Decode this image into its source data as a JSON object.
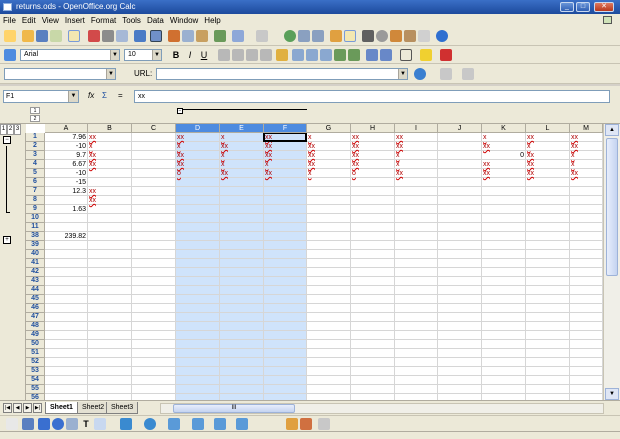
{
  "window": {
    "title": "returns.ods - OpenOffice.org Calc"
  },
  "menu": [
    "File",
    "Edit",
    "View",
    "Insert",
    "Format",
    "Tools",
    "Data",
    "Window",
    "Help"
  ],
  "format_toolbar": {
    "font_name": "Arial",
    "font_size": "10"
  },
  "url_toolbar": {
    "url_label": "URL:",
    "url_value": ""
  },
  "formula_bar": {
    "cell_ref": "F1",
    "content": "xx"
  },
  "outline_levels": [
    "1",
    "2",
    "3"
  ],
  "outline_col_levels": [
    "1",
    "2"
  ],
  "columns": [
    "A",
    "B",
    "C",
    "D",
    "E",
    "F",
    "G",
    "H",
    "I",
    "J",
    "K",
    "L",
    "M"
  ],
  "selected_columns": [
    "D",
    "E",
    "F"
  ],
  "rows": [
    "1",
    "2",
    "3",
    "4",
    "5",
    "6",
    "7",
    "8",
    "9",
    "10",
    "11",
    "38",
    "39",
    "40",
    "41",
    "42",
    "43",
    "44",
    "45",
    "46",
    "47",
    "48",
    "49",
    "50",
    "51",
    "52",
    "53",
    "54",
    "55",
    "56"
  ],
  "cells": {
    "A": {
      "1": "7.96",
      "2": "-10",
      "3": "9.7",
      "4": "6.67",
      "5": "-10",
      "6": "-15",
      "7": "12.3",
      "9": "1.63",
      "38": "239.82"
    },
    "B": {
      "1": "xx",
      "2": "x",
      "3": "xx",
      "4": "xx",
      "7": "xx",
      "8": "xx"
    },
    "D": {
      "1": "xx",
      "2": "x",
      "3": "xx",
      "4": "xx",
      "5": "o"
    },
    "E": {
      "1": "x",
      "2": "xx",
      "3": "x",
      "4": "x",
      "5": "xx"
    },
    "F": {
      "1": "xx",
      "2": "xx",
      "3": "xx",
      "4": "x",
      "5": "xx"
    },
    "G": {
      "1": "x",
      "2": "xx",
      "3": "xx",
      "4": "xx",
      "5": "x"
    },
    "H": {
      "1": "xx",
      "2": "xx",
      "3": "xx",
      "4": "xx",
      "5": "o"
    },
    "I": {
      "1": "xx",
      "2": "xx",
      "3": "x",
      "4": "x",
      "5": "xx"
    },
    "K": {
      "1": "x",
      "2": "xx",
      "3": "0",
      "4": "xx",
      "5": "xx"
    },
    "L": {
      "1": "xx",
      "2": "x",
      "3": "xx",
      "4": "xx",
      "5": "xx"
    },
    "M": {
      "1": "xx",
      "2": "xx",
      "3": "x",
      "4": "x",
      "5": "xx"
    }
  },
  "sheets": [
    "Sheet1",
    "Sheet2",
    "Sheet3"
  ],
  "active_sheet": "Sheet1",
  "scroll_thumb_label": "III",
  "colors": {
    "selection": "#cfe3fb",
    "header_selected": "#4d8be0",
    "row_number": "#1f4f9e",
    "spell_error": "#d00000"
  }
}
